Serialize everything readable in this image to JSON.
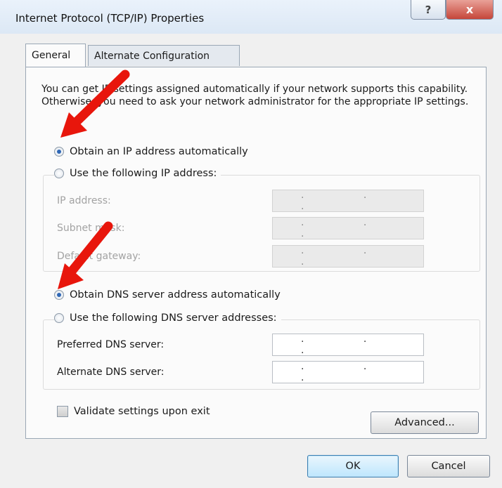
{
  "window": {
    "title": "Internet Protocol (TCP/IP) Properties",
    "help_glyph": "?",
    "close_glyph": "x"
  },
  "tabs": [
    {
      "label": "General",
      "active": true
    },
    {
      "label": "Alternate Configuration",
      "active": false
    }
  ],
  "description": "You can get IP settings assigned automatically if your network supports this capability. Otherwise, you need to ask your network administrator for the appropriate IP settings.",
  "ip_section": {
    "auto_label": "Obtain an IP address automatically",
    "auto_checked": true,
    "manual_label": "Use the following IP address:",
    "manual_checked": false,
    "fields": [
      {
        "label": "IP address:",
        "value": ". . ."
      },
      {
        "label": "Subnet mask:",
        "value": ". . ."
      },
      {
        "label": "Default gateway:",
        "value": ". . ."
      }
    ]
  },
  "dns_section": {
    "auto_label": "Obtain DNS server address automatically",
    "auto_checked": true,
    "manual_label": "Use the following DNS server addresses:",
    "manual_checked": false,
    "fields": [
      {
        "label": "Preferred DNS server:",
        "value": ". . ."
      },
      {
        "label": "Alternate DNS server:",
        "value": ". . ."
      }
    ]
  },
  "validate": {
    "label": "Validate settings upon exit",
    "checked": false
  },
  "buttons": {
    "advanced": "Advanced...",
    "ok": "OK",
    "cancel": "Cancel"
  },
  "annotation_arrow_color": "#e8160c"
}
